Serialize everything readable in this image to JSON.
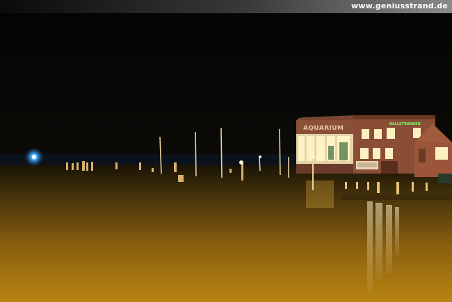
{
  "watermark": {
    "text": "www.geniusstrand.de"
  },
  "building": {
    "sign_main": "AQUARIUM",
    "sign_shop": "BALLSTRANDEN"
  },
  "colors": {
    "sky": "#060606",
    "water_glow": "#c88a10",
    "building_wall": "#8a4f38",
    "window_light": "#fff1c0",
    "beacon": "#3aa8ff"
  }
}
